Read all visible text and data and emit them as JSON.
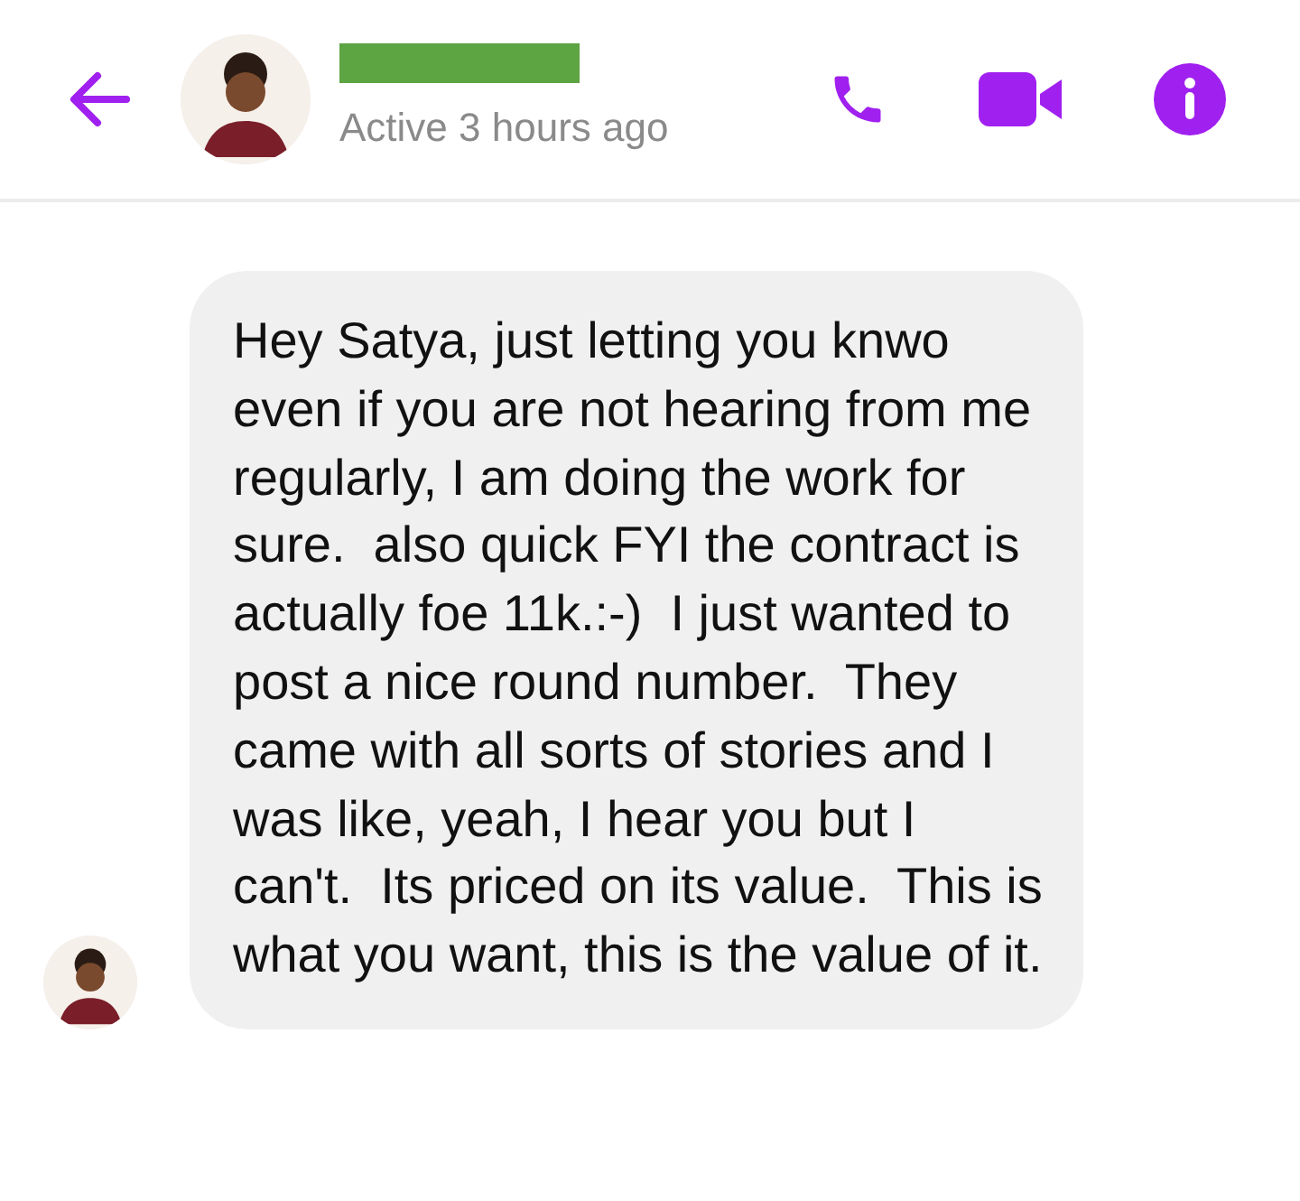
{
  "header": {
    "status": "Active 3 hours ago"
  },
  "messages": [
    {
      "text": "Hey Satya, just letting you knwo even if you are not hearing from me regularly, I am doing the work for sure.  also quick FYI the contract is actually foe 11k.:-)  I just wanted to post a nice round number.  They came with all sorts of stories and I was like, yeah, I hear you but I can't.  Its priced on its value.  This is what you want, this is the value of it."
    }
  ]
}
